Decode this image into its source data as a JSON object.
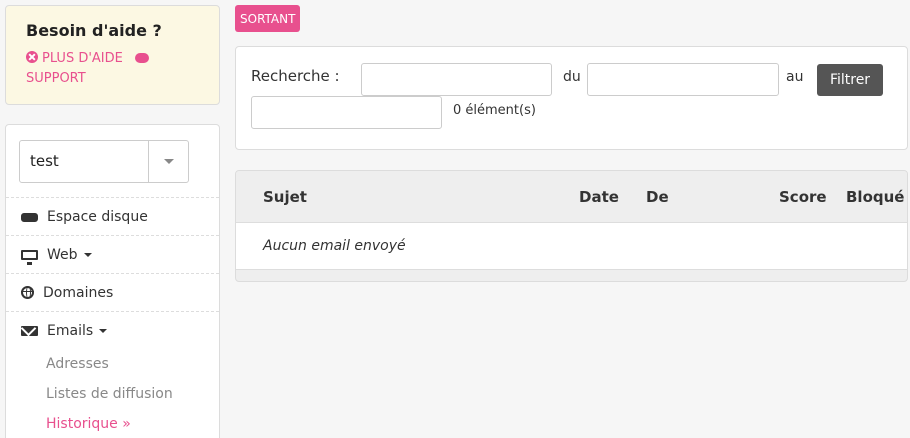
{
  "help": {
    "title": "Besoin d'aide ?",
    "more_help": "PLUS D'AIDE",
    "support": "SUPPORT"
  },
  "account_select": {
    "value": "test"
  },
  "nav": {
    "disk": "Espace disque",
    "web": "Web",
    "domains": "Domaines",
    "emails": "Emails",
    "sub": {
      "addresses": "Adresses",
      "lists": "Listes de diffusion",
      "history": "Historique »"
    }
  },
  "badge": "SORTANT",
  "search": {
    "label": "Recherche :",
    "from_label": "du",
    "to_label": "au",
    "filter_button": "Filtrer",
    "count": "0 élément(s)"
  },
  "table": {
    "columns": [
      "Sujet",
      "Date",
      "De",
      "Score",
      "Bloqué"
    ],
    "empty": "Aucun email envoyé"
  },
  "colors": {
    "accent": "#e8508e",
    "help_bg": "#fcf8e3",
    "button": "#555555"
  }
}
